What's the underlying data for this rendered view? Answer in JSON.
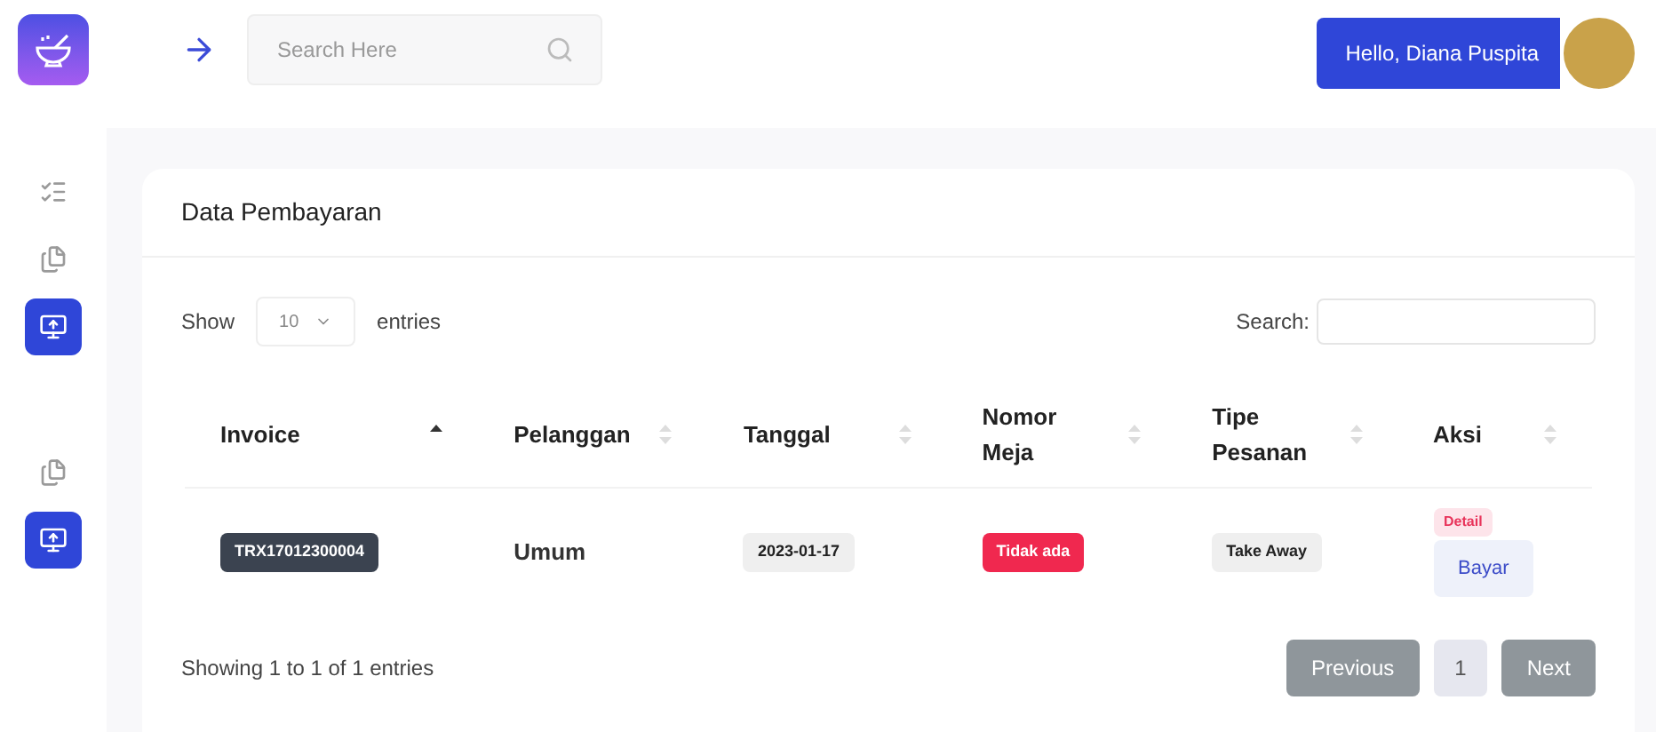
{
  "sidebar": {
    "groups": [
      [
        {
          "kind": "list",
          "selected": false
        },
        {
          "kind": "files",
          "selected": false
        },
        {
          "kind": "monitor",
          "selected": true
        }
      ],
      [
        {
          "kind": "files",
          "selected": false
        },
        {
          "kind": "monitor",
          "selected": true
        }
      ]
    ]
  },
  "header": {
    "search": {
      "placeholder": "Search Here"
    },
    "greeting": "Hello, Diana Puspita"
  },
  "card": {
    "title": "Data Pembayaran",
    "length": {
      "before": "Show",
      "value": "10",
      "after": "entries"
    },
    "search_label": "Search:",
    "table": {
      "columns": [
        {
          "label": "Invoice",
          "sorted": true
        },
        {
          "label": "Pelanggan",
          "sorted": false
        },
        {
          "label": "Tanggal",
          "sorted": false
        },
        {
          "label": "Nomor Meja",
          "sorted": false
        },
        {
          "label": "Tipe Pesanan",
          "sorted": false
        },
        {
          "label": "Aksi",
          "sorted": false
        }
      ],
      "rows": [
        [
          {
            "kind": "dark",
            "text": "TRX17012300004"
          },
          {
            "kind": "plain",
            "text": "Umum"
          },
          {
            "kind": "light",
            "text": "2023-01-17"
          },
          {
            "kind": "danger",
            "text": "Tidak ada"
          },
          {
            "kind": "light",
            "text": "Take Away"
          },
          {
            "kind": "actions",
            "detail": "Detail",
            "pay": "Bayar"
          }
        ]
      ]
    },
    "info": "Showing 1 to 1 of 1 entries",
    "pagination": [
      {
        "label": "Previous",
        "selected": false
      },
      {
        "label": "1",
        "selected": true
      },
      {
        "label": "Next",
        "selected": false
      }
    ]
  }
}
